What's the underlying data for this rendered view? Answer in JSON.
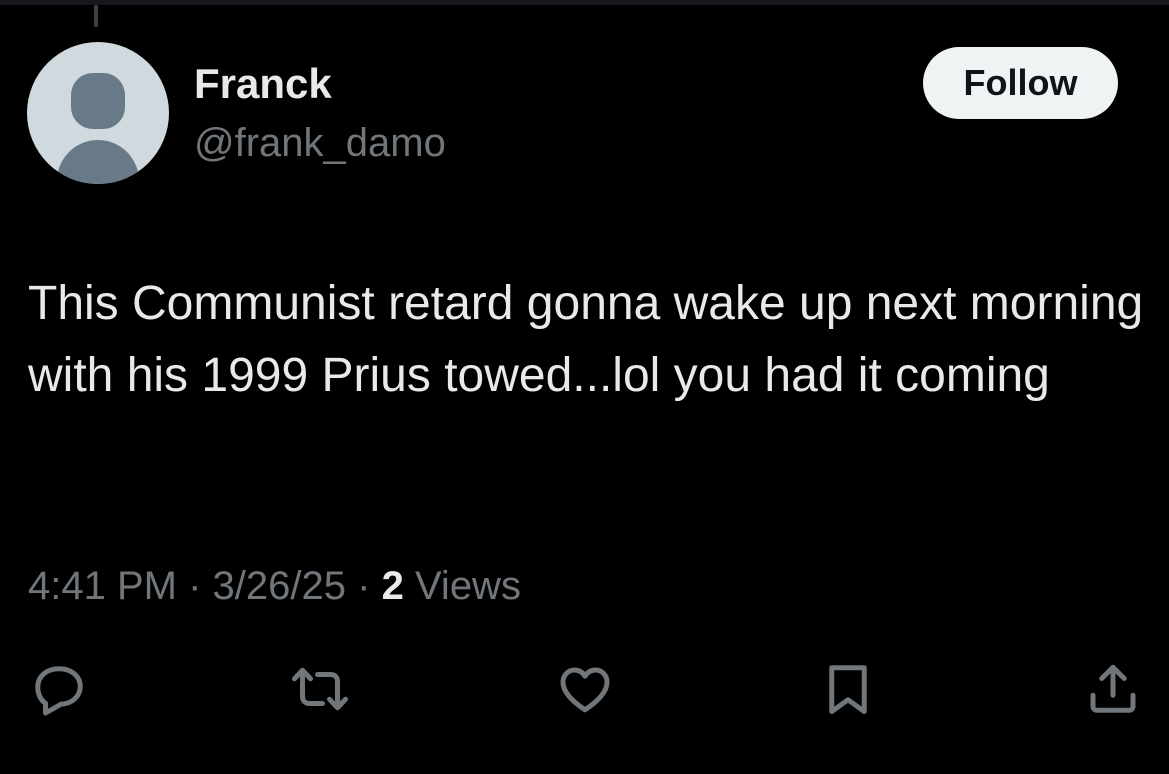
{
  "tweet": {
    "author": {
      "display_name": "Franck",
      "handle": "@frank_damo"
    },
    "follow_label": "Follow",
    "text": "This Communist retard gonna wake up next morning with his 1999 Prius towed...lol you had it coming",
    "time": "4:41 PM",
    "separator": "·",
    "date": "3/26/25",
    "views_count": "2",
    "views_label": "Views"
  },
  "icons": {
    "reply": "reply-icon",
    "retweet": "retweet-icon",
    "like": "heart-icon",
    "bookmark": "bookmark-icon",
    "share": "share-icon"
  },
  "colors": {
    "background": "#000000",
    "primary_text": "#e7e9ea",
    "secondary_text": "#71767b",
    "follow_button_bg": "#eff3f4",
    "avatar_bg": "#cfd9de",
    "avatar_figure": "#687987"
  }
}
